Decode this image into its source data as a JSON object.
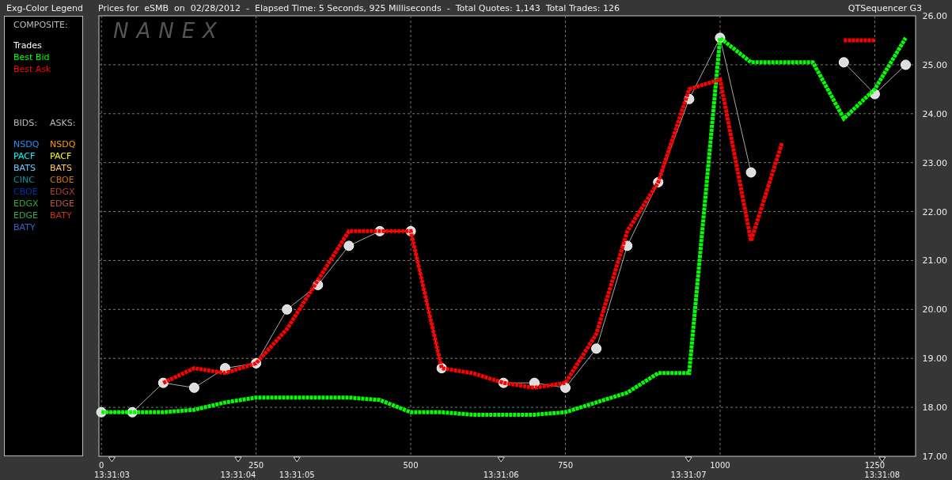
{
  "header": {
    "legend_title": "Exg-Color Legend",
    "info": "Prices for  eSMB  on  02/28/2012  -  Elapsed Time: 5 Seconds, 925 Milliseconds  -  Total Quotes: 1,143  Total Trades: 126",
    "app_name": "QTSequencer G3"
  },
  "legend": {
    "composite_heading": "COMPOSITE:",
    "bids_heading": "BIDS:",
    "asks_heading": "ASKS:",
    "bids": [
      {
        "label": "NSDQ",
        "color": "#1e90ff"
      },
      {
        "label": "PACF",
        "color": "#00ffff"
      },
      {
        "label": "BATS",
        "color": "#66ccff"
      },
      {
        "label": "CINC",
        "color": "#009999"
      },
      {
        "label": "CBOE",
        "color": "#0033aa"
      },
      {
        "label": "EDGX",
        "color": "#33aa33"
      },
      {
        "label": "EDGE",
        "color": "#33aa55"
      },
      {
        "label": "BATY",
        "color": "#3366cc"
      }
    ],
    "asks": [
      {
        "label": "NSDQ",
        "color": "#ff9900"
      },
      {
        "label": "PACF",
        "color": "#ffff00"
      },
      {
        "label": "BATS",
        "color": "#ffcc66"
      },
      {
        "label": "CBOE",
        "color": "#cc7700"
      },
      {
        "label": "EDGX",
        "color": "#aa4433"
      },
      {
        "label": "EDGE",
        "color": "#bb5544"
      },
      {
        "label": "BATY",
        "color": "#cc3311"
      }
    ]
  },
  "chart": {
    "logo": "NANEX",
    "time_labels": [
      "13:31:03",
      "13:31:04",
      "13:31:05",
      "13:31:06",
      "13:31:07",
      "13:31:08"
    ],
    "chart_data": {
      "type": "line",
      "grid": true,
      "x": [
        0,
        50,
        100,
        150,
        200,
        250,
        300,
        350,
        400,
        450,
        500,
        550,
        600,
        650,
        700,
        750,
        800,
        850,
        900,
        950,
        1000,
        1050,
        1100,
        1150,
        1200,
        1250,
        1300
      ],
      "xlim": [
        -4,
        1316
      ],
      "ylim": [
        17,
        26
      ],
      "xticks": [
        0,
        250,
        500,
        750,
        1000,
        1250
      ],
      "yticks": [
        {
          "value": 17,
          "label": "17.00"
        },
        {
          "value": 18,
          "label": "18.00"
        },
        {
          "value": 19,
          "label": "19.00"
        },
        {
          "value": 20,
          "label": "20.00"
        },
        {
          "value": 21,
          "label": "21.00"
        },
        {
          "value": 22,
          "label": "22.00"
        },
        {
          "value": 23,
          "label": "23.00"
        },
        {
          "value": 24,
          "label": "24.00"
        },
        {
          "value": 25,
          "label": "25.00"
        },
        {
          "value": 26,
          "label": "26.00"
        }
      ],
      "series": [
        {
          "name": "Trades",
          "color": "#ffffff",
          "line_style": "solid",
          "marker": "circle",
          "values": [
            17.9,
            17.9,
            18.5,
            18.4,
            18.8,
            18.9,
            20.0,
            20.5,
            21.3,
            21.6,
            21.6,
            18.8,
            null,
            18.5,
            18.5,
            18.4,
            19.2,
            21.3,
            22.6,
            24.3,
            25.55,
            22.8,
            null,
            null,
            25.05,
            24.4,
            25.0
          ]
        },
        {
          "name": "Best Bid",
          "color": "#00ff00",
          "line_style": "dotted",
          "values": [
            17.9,
            17.9,
            17.9,
            17.95,
            18.1,
            18.2,
            18.2,
            18.2,
            18.2,
            18.15,
            17.9,
            17.9,
            17.85,
            17.85,
            17.85,
            17.9,
            18.1,
            18.3,
            18.7,
            18.7,
            25.55,
            25.05,
            25.05,
            25.05,
            23.9,
            24.5,
            25.55
          ]
        },
        {
          "name": "Best Ask",
          "color": "#ff0000",
          "line_style": "dotted",
          "values": [
            null,
            null,
            18.5,
            18.8,
            18.7,
            18.9,
            19.6,
            20.6,
            21.6,
            21.6,
            21.6,
            18.8,
            18.7,
            18.5,
            18.4,
            18.5,
            19.5,
            21.6,
            22.6,
            24.5,
            24.7,
            21.4,
            23.4,
            null,
            25.5,
            25.5,
            null
          ]
        }
      ]
    }
  }
}
